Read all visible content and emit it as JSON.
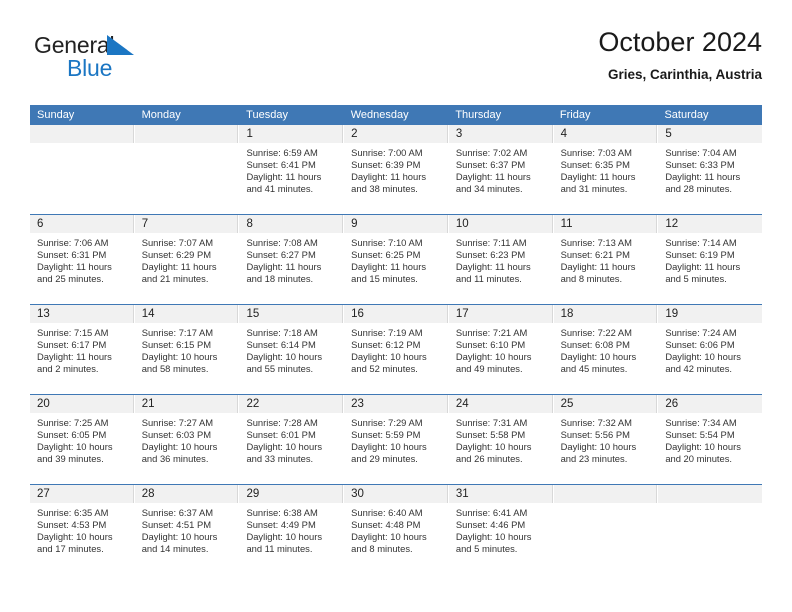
{
  "brand": {
    "name_top": "General",
    "name_bottom": "Blue",
    "triangle_color": "#1B76C3",
    "text_color": "#222222",
    "blue_color": "#1B76C3"
  },
  "header": {
    "title": "October 2024",
    "subtitle": "Gries, Carinthia, Austria"
  },
  "theme": {
    "header_blue": "#3F78B5",
    "daynum_bg": "#F1F1F1",
    "cell_bg": "#FFFFFF",
    "text": "#333333"
  },
  "weekdays": [
    "Sunday",
    "Monday",
    "Tuesday",
    "Wednesday",
    "Thursday",
    "Friday",
    "Saturday"
  ],
  "weeks": [
    [
      {
        "day": "",
        "lines": []
      },
      {
        "day": "",
        "lines": []
      },
      {
        "day": "1",
        "lines": [
          "Sunrise: 6:59 AM",
          "Sunset: 6:41 PM",
          "Daylight: 11 hours",
          "and 41 minutes."
        ]
      },
      {
        "day": "2",
        "lines": [
          "Sunrise: 7:00 AM",
          "Sunset: 6:39 PM",
          "Daylight: 11 hours",
          "and 38 minutes."
        ]
      },
      {
        "day": "3",
        "lines": [
          "Sunrise: 7:02 AM",
          "Sunset: 6:37 PM",
          "Daylight: 11 hours",
          "and 34 minutes."
        ]
      },
      {
        "day": "4",
        "lines": [
          "Sunrise: 7:03 AM",
          "Sunset: 6:35 PM",
          "Daylight: 11 hours",
          "and 31 minutes."
        ]
      },
      {
        "day": "5",
        "lines": [
          "Sunrise: 7:04 AM",
          "Sunset: 6:33 PM",
          "Daylight: 11 hours",
          "and 28 minutes."
        ]
      }
    ],
    [
      {
        "day": "6",
        "lines": [
          "Sunrise: 7:06 AM",
          "Sunset: 6:31 PM",
          "Daylight: 11 hours",
          "and 25 minutes."
        ]
      },
      {
        "day": "7",
        "lines": [
          "Sunrise: 7:07 AM",
          "Sunset: 6:29 PM",
          "Daylight: 11 hours",
          "and 21 minutes."
        ]
      },
      {
        "day": "8",
        "lines": [
          "Sunrise: 7:08 AM",
          "Sunset: 6:27 PM",
          "Daylight: 11 hours",
          "and 18 minutes."
        ]
      },
      {
        "day": "9",
        "lines": [
          "Sunrise: 7:10 AM",
          "Sunset: 6:25 PM",
          "Daylight: 11 hours",
          "and 15 minutes."
        ]
      },
      {
        "day": "10",
        "lines": [
          "Sunrise: 7:11 AM",
          "Sunset: 6:23 PM",
          "Daylight: 11 hours",
          "and 11 minutes."
        ]
      },
      {
        "day": "11",
        "lines": [
          "Sunrise: 7:13 AM",
          "Sunset: 6:21 PM",
          "Daylight: 11 hours",
          "and 8 minutes."
        ]
      },
      {
        "day": "12",
        "lines": [
          "Sunrise: 7:14 AM",
          "Sunset: 6:19 PM",
          "Daylight: 11 hours",
          "and 5 minutes."
        ]
      }
    ],
    [
      {
        "day": "13",
        "lines": [
          "Sunrise: 7:15 AM",
          "Sunset: 6:17 PM",
          "Daylight: 11 hours",
          "and 2 minutes."
        ]
      },
      {
        "day": "14",
        "lines": [
          "Sunrise: 7:17 AM",
          "Sunset: 6:15 PM",
          "Daylight: 10 hours",
          "and 58 minutes."
        ]
      },
      {
        "day": "15",
        "lines": [
          "Sunrise: 7:18 AM",
          "Sunset: 6:14 PM",
          "Daylight: 10 hours",
          "and 55 minutes."
        ]
      },
      {
        "day": "16",
        "lines": [
          "Sunrise: 7:19 AM",
          "Sunset: 6:12 PM",
          "Daylight: 10 hours",
          "and 52 minutes."
        ]
      },
      {
        "day": "17",
        "lines": [
          "Sunrise: 7:21 AM",
          "Sunset: 6:10 PM",
          "Daylight: 10 hours",
          "and 49 minutes."
        ]
      },
      {
        "day": "18",
        "lines": [
          "Sunrise: 7:22 AM",
          "Sunset: 6:08 PM",
          "Daylight: 10 hours",
          "and 45 minutes."
        ]
      },
      {
        "day": "19",
        "lines": [
          "Sunrise: 7:24 AM",
          "Sunset: 6:06 PM",
          "Daylight: 10 hours",
          "and 42 minutes."
        ]
      }
    ],
    [
      {
        "day": "20",
        "lines": [
          "Sunrise: 7:25 AM",
          "Sunset: 6:05 PM",
          "Daylight: 10 hours",
          "and 39 minutes."
        ]
      },
      {
        "day": "21",
        "lines": [
          "Sunrise: 7:27 AM",
          "Sunset: 6:03 PM",
          "Daylight: 10 hours",
          "and 36 minutes."
        ]
      },
      {
        "day": "22",
        "lines": [
          "Sunrise: 7:28 AM",
          "Sunset: 6:01 PM",
          "Daylight: 10 hours",
          "and 33 minutes."
        ]
      },
      {
        "day": "23",
        "lines": [
          "Sunrise: 7:29 AM",
          "Sunset: 5:59 PM",
          "Daylight: 10 hours",
          "and 29 minutes."
        ]
      },
      {
        "day": "24",
        "lines": [
          "Sunrise: 7:31 AM",
          "Sunset: 5:58 PM",
          "Daylight: 10 hours",
          "and 26 minutes."
        ]
      },
      {
        "day": "25",
        "lines": [
          "Sunrise: 7:32 AM",
          "Sunset: 5:56 PM",
          "Daylight: 10 hours",
          "and 23 minutes."
        ]
      },
      {
        "day": "26",
        "lines": [
          "Sunrise: 7:34 AM",
          "Sunset: 5:54 PM",
          "Daylight: 10 hours",
          "and 20 minutes."
        ]
      }
    ],
    [
      {
        "day": "27",
        "lines": [
          "Sunrise: 6:35 AM",
          "Sunset: 4:53 PM",
          "Daylight: 10 hours",
          "and 17 minutes."
        ]
      },
      {
        "day": "28",
        "lines": [
          "Sunrise: 6:37 AM",
          "Sunset: 4:51 PM",
          "Daylight: 10 hours",
          "and 14 minutes."
        ]
      },
      {
        "day": "29",
        "lines": [
          "Sunrise: 6:38 AM",
          "Sunset: 4:49 PM",
          "Daylight: 10 hours",
          "and 11 minutes."
        ]
      },
      {
        "day": "30",
        "lines": [
          "Sunrise: 6:40 AM",
          "Sunset: 4:48 PM",
          "Daylight: 10 hours",
          "and 8 minutes."
        ]
      },
      {
        "day": "31",
        "lines": [
          "Sunrise: 6:41 AM",
          "Sunset: 4:46 PM",
          "Daylight: 10 hours",
          "and 5 minutes."
        ]
      },
      {
        "day": "",
        "lines": []
      },
      {
        "day": "",
        "lines": []
      }
    ]
  ]
}
